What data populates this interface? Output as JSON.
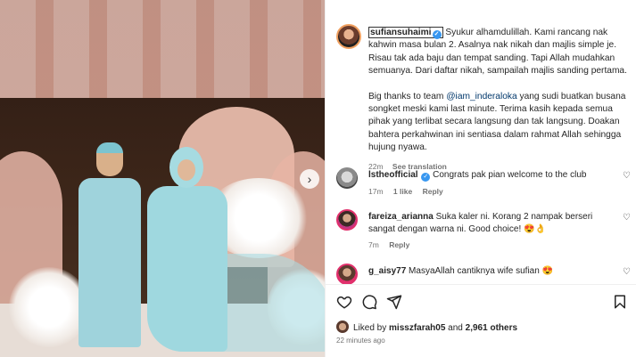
{
  "post": {
    "username": "sufiansuhaimi",
    "caption_p1": "Syukur alhamdulillah. Kami rancang nak kahwin masa bulan 2. Asalnya nak nikah dan majlis simple je. Risau tak ada baju dan tempat sanding. Tapi Allah mudahkan semuanya. Dari daftar nikah, sampailah majlis sanding pertama.",
    "caption_p2_before": "Big thanks to team ",
    "caption_mention": "@iam_inderaloka",
    "caption_p2_after": " yang sudi buatkan busana songket meski kami last minute. Terima kasih kepada semua pihak yang terlibat secara langsung dan tak langsung. Doakan bahtera perkahwinan ini sentiasa dalam rahmat Allah sehingga hujung nyawa.",
    "time": "22m",
    "see_translation": "See translation",
    "carousel_next": "›"
  },
  "comments": [
    {
      "username": "lstheofficial",
      "verified": true,
      "text": "Congrats pak pian welcome to the club",
      "time": "17m",
      "likes": "1 like",
      "reply": "Reply"
    },
    {
      "username": "fareiza_arianna",
      "text": "Suka kaler ni. Korang 2 nampak berseri sangat dengan warna ni. Good choice!",
      "emojis": "😍👌",
      "time": "7m",
      "reply": "Reply"
    },
    {
      "username": "g_aisy77",
      "text": "MasyaAllah cantiknya wife sufian",
      "emojis": "😍"
    }
  ],
  "footer": {
    "liked_by_prefix": "Liked by ",
    "liked_by_user": "misszfarah05",
    "liked_by_and": " and ",
    "liked_by_count": "2,961 others",
    "time_ago": "22 minutes ago"
  },
  "icons": {
    "heart": "heart-icon",
    "comment": "comment-icon",
    "share": "share-icon",
    "save": "bookmark-icon",
    "verified": "verified-badge-icon"
  }
}
